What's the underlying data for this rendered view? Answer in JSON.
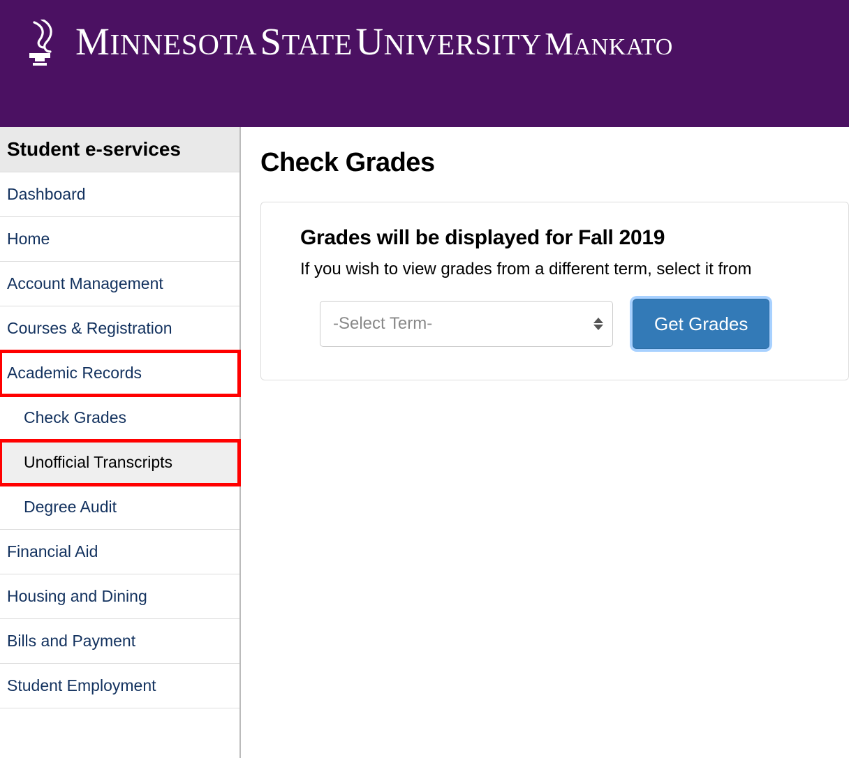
{
  "banner": {
    "university": "Minnesota State University",
    "campus": "Mankato"
  },
  "sidebar": {
    "title": "Student e-services",
    "items": [
      {
        "label": "Dashboard",
        "sub": false,
        "highlight": false,
        "selected": false
      },
      {
        "label": "Home",
        "sub": false,
        "highlight": false,
        "selected": false
      },
      {
        "label": "Account Management",
        "sub": false,
        "highlight": false,
        "selected": false
      },
      {
        "label": "Courses & Registration",
        "sub": false,
        "highlight": false,
        "selected": false
      },
      {
        "label": "Academic Records",
        "sub": false,
        "highlight": true,
        "selected": false
      },
      {
        "label": "Check Grades",
        "sub": true,
        "highlight": false,
        "selected": false
      },
      {
        "label": "Unofficial Transcripts",
        "sub": true,
        "highlight": true,
        "selected": true
      },
      {
        "label": "Degree Audit",
        "sub": true,
        "highlight": false,
        "selected": false
      },
      {
        "label": "Financial Aid",
        "sub": false,
        "highlight": false,
        "selected": false
      },
      {
        "label": "Housing and Dining",
        "sub": false,
        "highlight": false,
        "selected": false
      },
      {
        "label": "Bills and Payment",
        "sub": false,
        "highlight": false,
        "selected": false
      },
      {
        "label": "Student Employment",
        "sub": false,
        "highlight": false,
        "selected": false
      }
    ]
  },
  "main": {
    "title": "Check Grades",
    "panel_heading": "Grades will be displayed for Fall 2019",
    "panel_subtext": "If you wish to view grades from a different term, select it from",
    "select_placeholder": "-Select Term-",
    "button_label": "Get Grades"
  }
}
